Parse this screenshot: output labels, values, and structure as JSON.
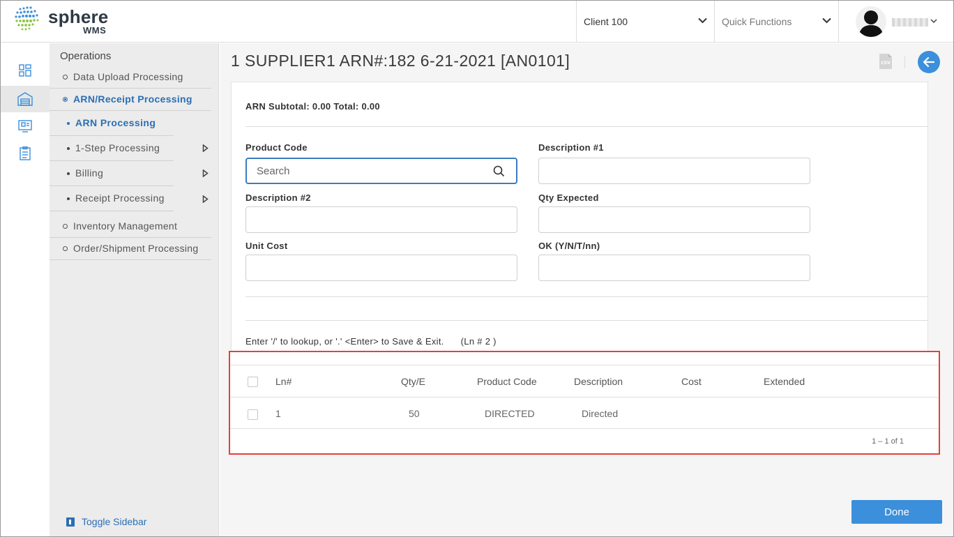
{
  "brand": {
    "name": "sphere",
    "sub": "WMS"
  },
  "header": {
    "client": "Client 100",
    "quick_functions_placeholder": "Quick Functions"
  },
  "sidebar": {
    "title": "Operations",
    "items": [
      {
        "label": "Data Upload Processing"
      },
      {
        "label": "ARN/Receipt Processing"
      },
      {
        "label": "Inventory Management"
      },
      {
        "label": "Order/Shipment Processing"
      }
    ],
    "subitems": [
      {
        "label": "ARN Processing"
      },
      {
        "label": "1-Step Processing"
      },
      {
        "label": "Billing"
      },
      {
        "label": "Receipt Processing"
      }
    ],
    "toggle_label": "Toggle Sidebar"
  },
  "main": {
    "title": "1 SUPPLIER1 ARN#:182 6-21-2021 [AN0101]",
    "csv_label": "CSV",
    "subtotal": "ARN Subtotal: 0.00 Total: 0.00",
    "fields": {
      "product_code_label": "Product Code",
      "product_code_placeholder": "Search",
      "desc1_label": "Description #1",
      "desc2_label": "Description #2",
      "qty_expected_label": "Qty Expected",
      "unit_cost_label": "Unit Cost",
      "ok_label": "OK (Y/N/T/nn)"
    },
    "hint": "Enter '/' to lookup, or '.' <Enter> to Save & Exit.",
    "line_number": "(Ln # 2 )",
    "table": {
      "headers": [
        "Ln#",
        "Qty/E",
        "Product Code",
        "Description",
        "Cost",
        "Extended"
      ],
      "rows": [
        {
          "ln": "1",
          "qty": "50",
          "product_code": "DIRECTED",
          "description": "Directed",
          "cost": "",
          "extended": ""
        }
      ],
      "pager": "1 – 1 of 1"
    },
    "done_label": "Done"
  },
  "colors": {
    "accent": "#3b8fdb",
    "active_text": "#2b6fb3",
    "highlight_border": "#e0423c"
  }
}
